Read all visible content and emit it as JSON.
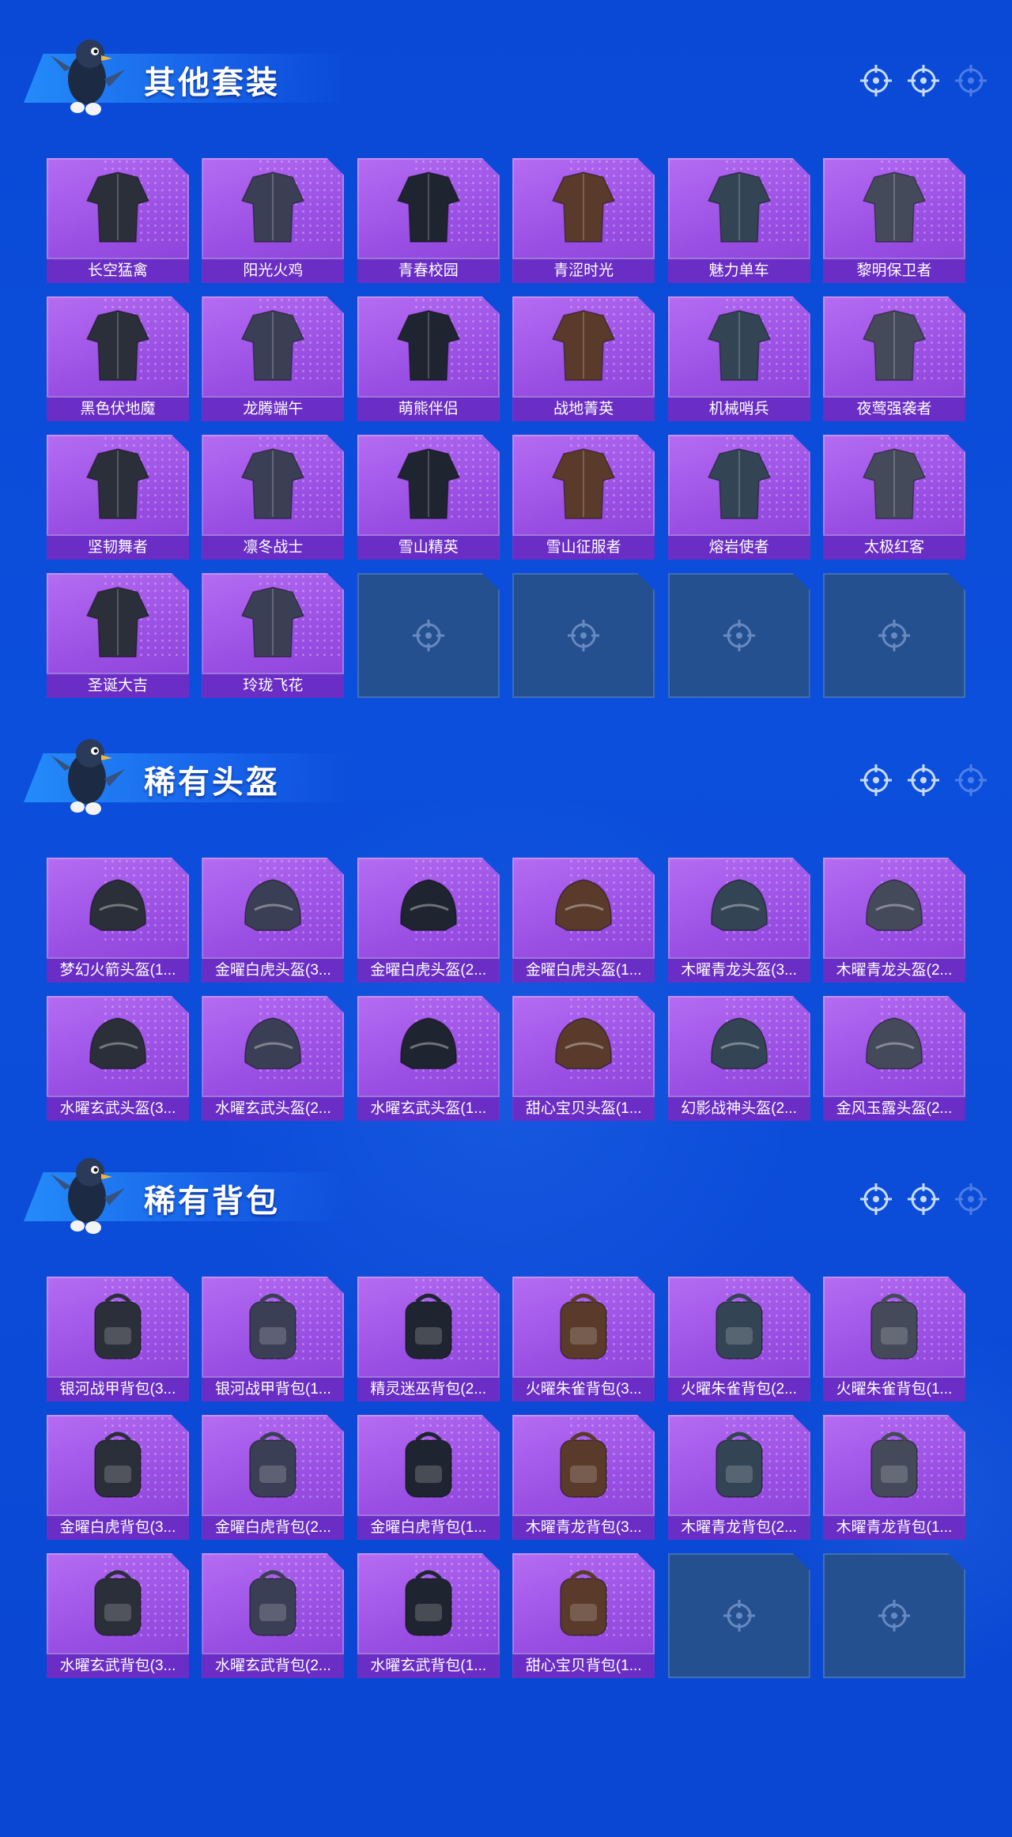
{
  "sections": [
    {
      "title": "其他套装",
      "items": [
        "长空猛禽",
        "阳光火鸡",
        "青春校园",
        "青涩时光",
        "魅力单车",
        "黎明保卫者",
        "黑色伏地魔",
        "龙腾端午",
        "萌熊伴侣",
        "战地菁英",
        "机械哨兵",
        "夜莺强袭者",
        "坚韧舞者",
        "凛冬战士",
        "雪山精英",
        "雪山征服者",
        "熔岩使者",
        "太极红客",
        "圣诞大吉",
        "玲珑飞花"
      ]
    },
    {
      "title": "稀有头盔",
      "items": [
        "梦幻火箭头盔(1...",
        "金曜白虎头盔(3...",
        "金曜白虎头盔(2...",
        "金曜白虎头盔(1...",
        "木曜青龙头盔(3...",
        "木曜青龙头盔(2...",
        "水曜玄武头盔(3...",
        "水曜玄武头盔(2...",
        "水曜玄武头盔(1...",
        "甜心宝贝头盔(1...",
        "幻影战神头盔(2...",
        "金风玉露头盔(2..."
      ]
    },
    {
      "title": "稀有背包",
      "items": [
        "银河战甲背包(3...",
        "银河战甲背包(1...",
        "精灵迷巫背包(2...",
        "火曜朱雀背包(3...",
        "火曜朱雀背包(2...",
        "火曜朱雀背包(1...",
        "金曜白虎背包(3...",
        "金曜白虎背包(2...",
        "金曜白虎背包(1...",
        "木曜青龙背包(3...",
        "木曜青龙背包(2...",
        "木曜青龙背包(1...",
        "水曜玄武背包(3...",
        "水曜玄武背包(2...",
        "水曜玄武背包(1...",
        "甜心宝贝背包(1..."
      ]
    }
  ],
  "grid_columns": 6,
  "colors": {
    "background": "#0a49d6",
    "card_purple": "#a35ae8",
    "label_bar": "#6a2ec6",
    "empty_slot": "#24508f"
  },
  "icons": {
    "header_targets": [
      "crosshair-icon",
      "crosshair-icon",
      "crosshair-icon"
    ],
    "empty_slot": "crosshair-icon",
    "mascot": "pigeon-mascot-icon"
  }
}
